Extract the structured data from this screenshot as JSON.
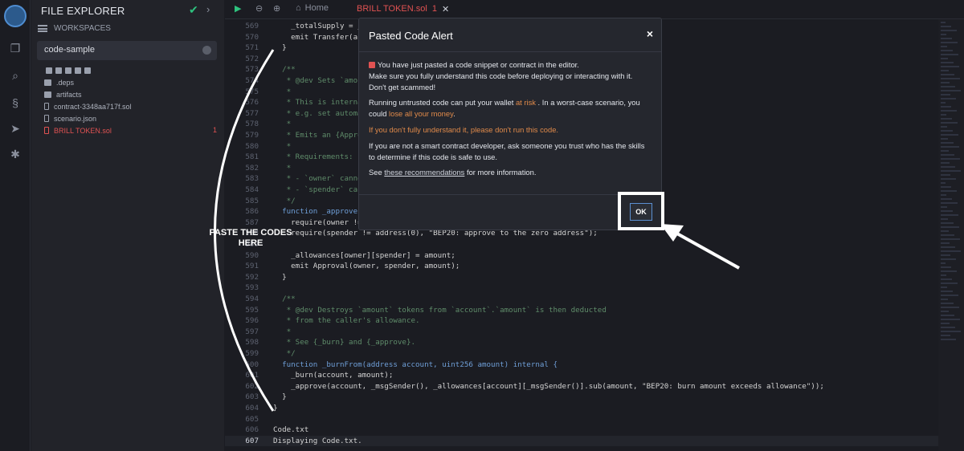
{
  "explorer": {
    "title": "FILE EXPLORER",
    "workspaces_label": "WORKSPACES",
    "workspace_selected": "code-sample",
    "items": [
      {
        "label": ".deps",
        "kind": "folder"
      },
      {
        "label": "artifacts",
        "kind": "folder"
      },
      {
        "label": "contract-3348aa717f.sol",
        "kind": "file"
      },
      {
        "label": "scenario.json",
        "kind": "json"
      },
      {
        "label": "BRILL TOKEN.sol",
        "kind": "file",
        "error": true
      }
    ],
    "error_count": "1"
  },
  "tabs": {
    "home_label": "Home",
    "active_file": "BRILL TOKEN.sol",
    "active_file_errors": "1"
  },
  "code_lines": [
    {
      "n": "569",
      "text": "    _totalSupply = _",
      "cls": ""
    },
    {
      "n": "570",
      "text": "    emit Transfer(ac",
      "cls": ""
    },
    {
      "n": "571",
      "text": "  }",
      "cls": ""
    },
    {
      "n": "572",
      "text": "",
      "cls": ""
    },
    {
      "n": "573",
      "text": "  /**",
      "cls": "cm"
    },
    {
      "n": "574",
      "text": "   * @dev Sets `amou",
      "cls": "cm"
    },
    {
      "n": "575",
      "text": "   *",
      "cls": "cm"
    },
    {
      "n": "576",
      "text": "   * This is interna",
      "cls": "cm"
    },
    {
      "n": "577",
      "text": "   * e.g. set automa",
      "cls": "cm"
    },
    {
      "n": "578",
      "text": "   *",
      "cls": "cm"
    },
    {
      "n": "579",
      "text": "   * Emits an {Appro",
      "cls": "cm"
    },
    {
      "n": "580",
      "text": "   *",
      "cls": "cm"
    },
    {
      "n": "581",
      "text": "   * Requirements:",
      "cls": "cm"
    },
    {
      "n": "582",
      "text": "   *",
      "cls": "cm"
    },
    {
      "n": "583",
      "text": "   * - `owner` canno",
      "cls": "cm"
    },
    {
      "n": "584",
      "text": "   * - `spender` can",
      "cls": "cm"
    },
    {
      "n": "585",
      "text": "   */",
      "cls": "cm"
    },
    {
      "n": "586",
      "text": "  function _approve",
      "cls": "kw"
    },
    {
      "n": "587",
      "text": "    require(owner !=",
      "cls": ""
    },
    {
      "n": "588",
      "text": "    require(spender != address(0), \"BEP20: approve to the zero address\");",
      "cls": ""
    },
    {
      "n": "589",
      "text": "",
      "cls": ""
    },
    {
      "n": "590",
      "text": "    _allowances[owner][spender] = amount;",
      "cls": ""
    },
    {
      "n": "591",
      "text": "    emit Approval(owner, spender, amount);",
      "cls": ""
    },
    {
      "n": "592",
      "text": "  }",
      "cls": ""
    },
    {
      "n": "593",
      "text": "",
      "cls": ""
    },
    {
      "n": "594",
      "text": "  /**",
      "cls": "cm"
    },
    {
      "n": "595",
      "text": "   * @dev Destroys `amount` tokens from `account`.`amount` is then deducted",
      "cls": "cm"
    },
    {
      "n": "596",
      "text": "   * from the caller's allowance.",
      "cls": "cm"
    },
    {
      "n": "597",
      "text": "   *",
      "cls": "cm"
    },
    {
      "n": "598",
      "text": "   * See {_burn} and {_approve}.",
      "cls": "cm"
    },
    {
      "n": "599",
      "text": "   */",
      "cls": "cm"
    },
    {
      "n": "600",
      "text": "  function _burnFrom(address account, uint256 amount) internal {",
      "cls": "kw"
    },
    {
      "n": "601",
      "text": "    _burn(account, amount);",
      "cls": ""
    },
    {
      "n": "602",
      "text": "    _approve(account, _msgSender(), _allowances[account][_msgSender()].sub(amount, \"BEP20: burn amount exceeds allowance\"));",
      "cls": ""
    },
    {
      "n": "603",
      "text": "  }",
      "cls": ""
    },
    {
      "n": "604",
      "text": "}",
      "cls": ""
    },
    {
      "n": "605",
      "text": "",
      "cls": ""
    },
    {
      "n": "606",
      "text": "Code.txt",
      "cls": ""
    },
    {
      "n": "607",
      "text": "Displaying Code.txt.",
      "cls": ""
    }
  ],
  "annotation": {
    "label_line1": "PASTE THE CODES",
    "label_line2": "HERE"
  },
  "modal": {
    "title": "Pasted Code Alert",
    "close_glyph": "×",
    "p1_a": "You have just pasted a code snippet or contract in the editor.",
    "p1_b": "Make sure you fully understand this code before deploying or interacting with it.",
    "p1_c": "Don't get scammed!",
    "p2_a": "Running untrusted code can put your wallet ",
    "p2_risk": "at risk",
    "p2_b": " . In a worst-case scenario, you could ",
    "p2_lose": "lose all your money",
    "p2_c": ".",
    "p3": "If you don't fully understand it, please don't run this code.",
    "p4": "If you are not a smart contract developer, ask someone you trust who has the skills to determine if this code is safe to use.",
    "p5_a": "See ",
    "p5_link": "these recommendations",
    "p5_b": " for more information.",
    "ok_label": "OK"
  },
  "colors": {
    "accent_blue": "#5b8fd1",
    "warning_orange": "#e08a4a",
    "error_red": "#e05252",
    "success_green": "#2ec27e"
  }
}
